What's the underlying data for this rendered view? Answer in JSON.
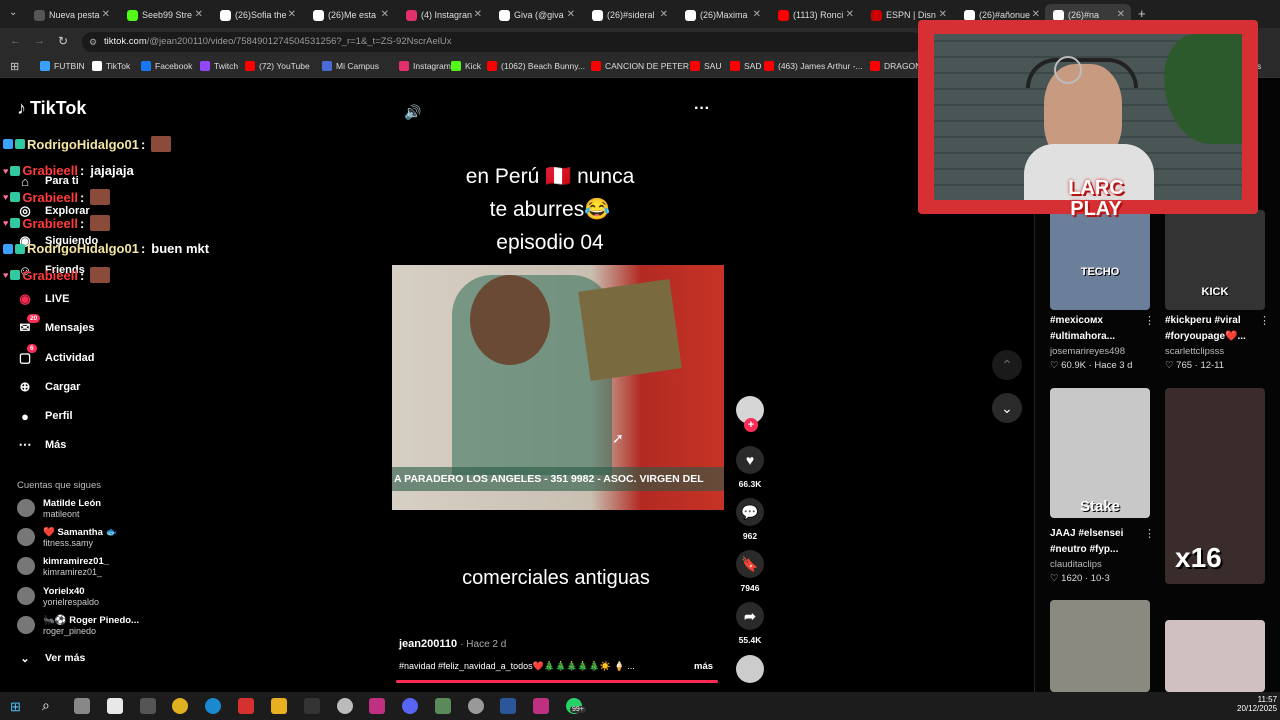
{
  "browser": {
    "tabs": [
      {
        "label": "Nueva pesta",
        "color": "#555555"
      },
      {
        "label": "Seeb99 Stre",
        "color": "#53fc18"
      },
      {
        "label": "(26)Sofia the",
        "color": "#ffffff"
      },
      {
        "label": "(26)Me esta",
        "color": "#ffffff"
      },
      {
        "label": "(4) Instagran",
        "color": "#e1306c"
      },
      {
        "label": "Giva (@giva",
        "color": "#ffffff"
      },
      {
        "label": "(26)#sideral",
        "color": "#ffffff"
      },
      {
        "label": "(26)Maxima",
        "color": "#ffffff"
      },
      {
        "label": "(1113) Ronci",
        "color": "#ff0000"
      },
      {
        "label": "ESPN | Disn",
        "color": "#cc0000"
      },
      {
        "label": "(26)#añonue",
        "color": "#ffffff"
      },
      {
        "label": "(26)#na",
        "color": "#ffffff"
      }
    ],
    "url_host": "tiktok.com",
    "url_rest": "/@jean200110/video/7584901274504531256?_r=1&_t=ZS-92NscrAelUx",
    "bookmarks": [
      {
        "label": "FUTBIN",
        "color": "#3aa0ff"
      },
      {
        "label": "TikTok",
        "color": "#ffffff"
      },
      {
        "label": "Facebook",
        "color": "#1877f2"
      },
      {
        "label": "Twitch",
        "color": "#9146ff"
      },
      {
        "label": "(72) YouTube",
        "color": "#ff0000"
      },
      {
        "label": "Mi Campus",
        "color": "#4b6bd6"
      },
      {
        "label": "Instagram",
        "color": "#e1306c"
      },
      {
        "label": "Kick",
        "color": "#53fc18"
      },
      {
        "label": "(1062) Beach Bunny...",
        "color": "#ff0000"
      },
      {
        "label": "CANCION DE PETER",
        "color": "#ff0000"
      },
      {
        "label": "SAU",
        "color": "#ff0000"
      },
      {
        "label": "SAD",
        "color": "#ff0000"
      },
      {
        "label": "(463) James Arthur -...",
        "color": "#ff0000"
      },
      {
        "label": "DRAGON B...",
        "color": "#ff0000"
      }
    ],
    "bookmarks_more": "dores"
  },
  "tiktok": {
    "logo": "TikTok",
    "nav": [
      {
        "label": "Para ti",
        "icon": "home-icon"
      },
      {
        "label": "Explorar",
        "icon": "compass-icon"
      },
      {
        "label": "Siguiendo",
        "icon": "following-icon"
      },
      {
        "label": "Friends",
        "icon": "friends-icon"
      },
      {
        "label": "LIVE",
        "icon": "live-icon"
      },
      {
        "label": "Mensajes",
        "icon": "messages-icon",
        "badge": "20"
      },
      {
        "label": "Actividad",
        "icon": "activity-icon",
        "badge": "6"
      },
      {
        "label": "Cargar",
        "icon": "upload-icon"
      },
      {
        "label": "Perfil",
        "icon": "profile-icon"
      },
      {
        "label": "Más",
        "icon": "more-icon"
      }
    ],
    "following_title": "Cuentas que sigues",
    "following": [
      {
        "name": "Matilde León",
        "handle": "matileont"
      },
      {
        "name": "❤️ Samantha 🐟",
        "handle": "fitness.samy"
      },
      {
        "name": "kimramirez01_",
        "handle": "kimramirez01_"
      },
      {
        "name": "Yorielx40",
        "handle": "yorielrespaldo"
      },
      {
        "name": "🐜⚽ Roger Pinedo...",
        "handle": "roger_pinedo"
      }
    ],
    "see_more": "Ver más"
  },
  "chat": [
    {
      "user": "RodrigoHidalgo01",
      "msg": "",
      "style": "u1"
    },
    {
      "user": "Grabieell",
      "msg": "jajajaja",
      "style": "u2"
    },
    {
      "user": "Grabieell",
      "msg": "",
      "style": "u2"
    },
    {
      "user": "Grabieell",
      "msg": "",
      "style": "u2"
    },
    {
      "user": "RodrigoHidalgo01",
      "msg": "buen mkt",
      "style": "u1"
    },
    {
      "user": "Grabieell",
      "msg": "",
      "style": "u2"
    }
  ],
  "video": {
    "title_line1": "en Perú 🇵🇪 nunca",
    "title_line2": "te aburres😂",
    "title_line3": "episodio 04",
    "ticker": "A PARADERO LOS ANGELES - 351 9982 - ASOC. VIRGEN DEL",
    "subtitle": "comerciales antiguas",
    "author": "jean200110",
    "time": "· Hace 2 d",
    "caption": "#navidad #feliz_navidad_a_todos❤️🎄🎄🎄🎄🎄☀️ 🍦 ...",
    "more": "más",
    "likes": "66.3K",
    "comments": "962",
    "saves": "7946",
    "shares": "55.4K"
  },
  "right_panel": [
    {
      "title1": "#mexicoᴍx",
      "title2": "#ultimahora...",
      "user": "josemarireyes498",
      "stats": "♡ 60.9K · Hace 3 d",
      "overlay": "TECHO",
      "thumb_color": "#6b7f9a"
    },
    {
      "title1": "#kickperu #viral",
      "title2": "#foryoupage❤️...",
      "user": "scarlettclipsss",
      "stats": "♡ 765 · 12-11",
      "overlay": "KICK",
      "thumb_color": "#333333"
    },
    {
      "title1": "JAAJ #elsensei",
      "title2": "#neutro #fyp...",
      "user": "clauditaclips",
      "stats": "♡ 1620 · 10-3",
      "overlay": "Stake",
      "thumb_color": "#c8c8c8"
    },
    {
      "title1": "",
      "title2": "",
      "user": "",
      "stats": "",
      "overlay": "x16",
      "thumb_color": "#3b2c2c"
    },
    {
      "title1": "",
      "title2": "",
      "user": "",
      "stats": "",
      "overlay": "",
      "thumb_color": "#8a8a80"
    },
    {
      "title1": "",
      "title2": "",
      "user": "",
      "stats": "",
      "overlay": "",
      "thumb_color": "#d0c0c0"
    }
  ],
  "overlay": {
    "brand": "LARC PLAY"
  },
  "taskbar": {
    "time": "11:57",
    "date": "20/12/2025",
    "whatsapp_badge": "99+"
  }
}
